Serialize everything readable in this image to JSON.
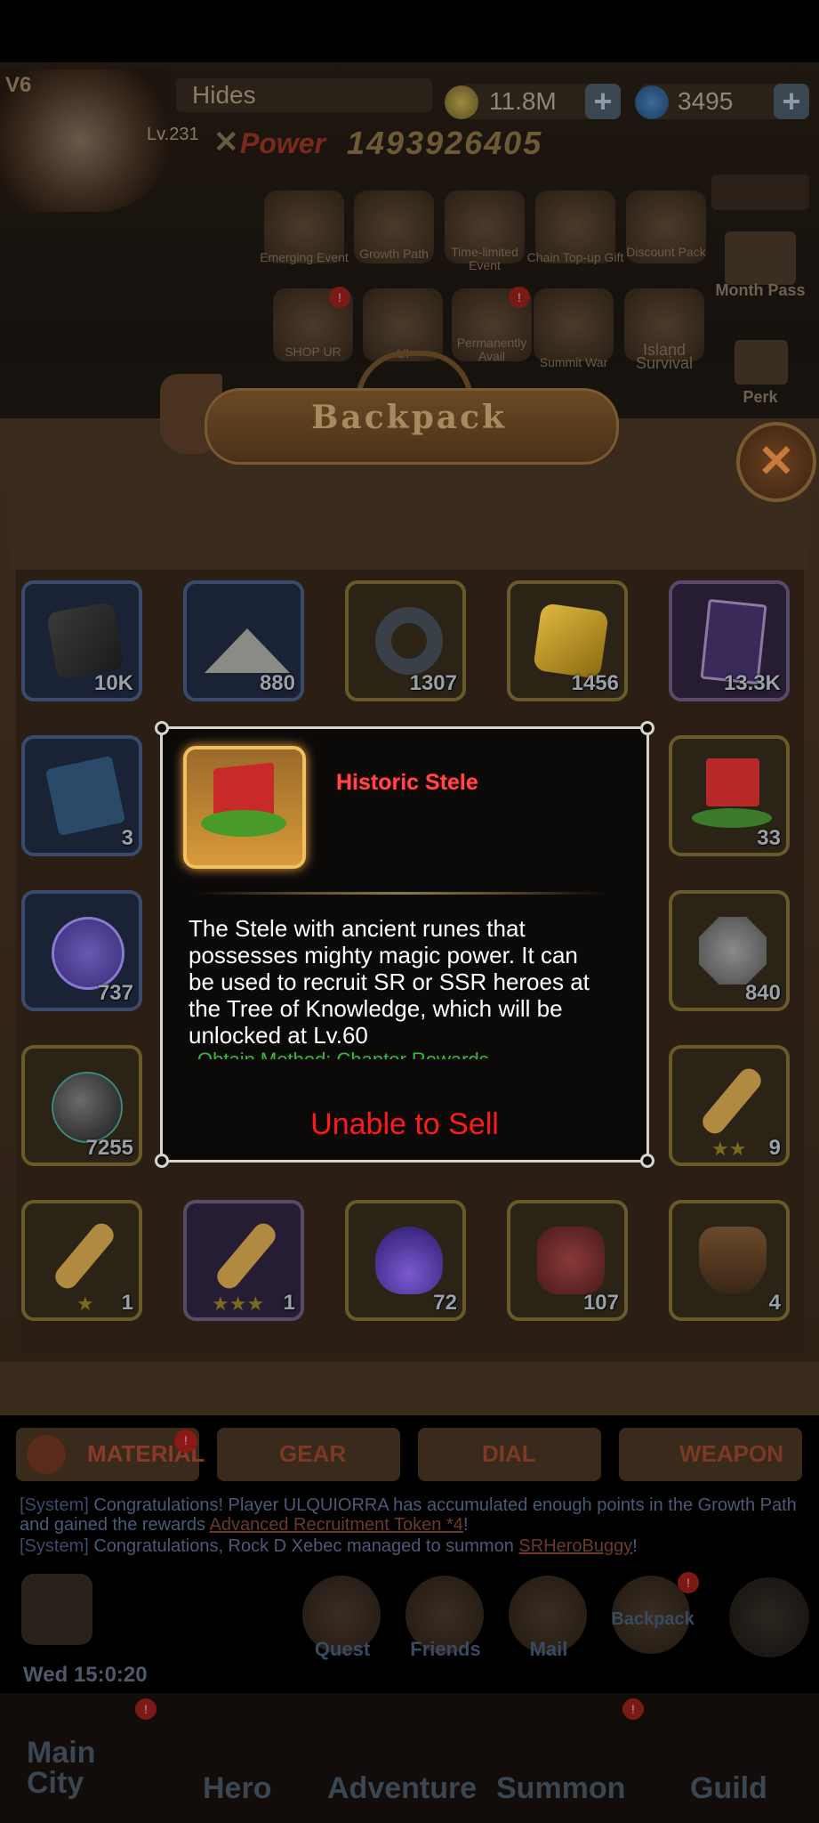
{
  "player": {
    "vip": "V6",
    "name": "Hides",
    "level": "Lv.231",
    "power_label": "Power",
    "power": "1493926405",
    "gold": "11.8M",
    "gems": "3495"
  },
  "events": [
    {
      "label": "Emerging Event"
    },
    {
      "label": "Growth Path"
    },
    {
      "label": "Time-limited Event"
    },
    {
      "label": "Chain Top-up Gift"
    },
    {
      "label": "Discount Pack"
    },
    {
      "label": "SHOP UR"
    },
    {
      "label": "Ul"
    },
    {
      "label": "Permanently Avail"
    },
    {
      "label": "Summit War"
    },
    {
      "label": "Island Survival"
    }
  ],
  "side_buttons": {
    "month_pass": "Month Pass",
    "perk": "Perk"
  },
  "backpack": {
    "title": "Backpack",
    "items": [
      {
        "qty": "10K",
        "frame": "blue",
        "icon": "ore-icon"
      },
      {
        "qty": "880",
        "frame": "blue",
        "icon": "dust-pile-icon"
      },
      {
        "qty": "1307",
        "frame": "gold",
        "icon": "compass-ring-icon"
      },
      {
        "qty": "1456",
        "frame": "gold",
        "icon": "gold-crystal-icon"
      },
      {
        "qty": "13.3K",
        "frame": "purple",
        "icon": "card-icon"
      },
      {
        "qty": "3",
        "frame": "blue",
        "icon": "book-icon"
      },
      {
        "qty": "33",
        "frame": "gold",
        "icon": "stele-icon"
      },
      {
        "qty": "737",
        "frame": "blue",
        "icon": "coin-icon"
      },
      {
        "qty": "840",
        "frame": "gold",
        "icon": "rune-stone-icon"
      },
      {
        "qty": "7255",
        "frame": "gold",
        "icon": "cannonball-icon"
      },
      {
        "qty": "9",
        "frame": "gold",
        "icon": "key-icon"
      },
      {
        "qty": "1",
        "frame": "gold",
        "icon": "key-icon"
      },
      {
        "qty": "1",
        "frame": "purple",
        "icon": "key-icon"
      },
      {
        "qty": "72",
        "frame": "gold",
        "icon": "flame-icon"
      },
      {
        "qty": "107",
        "frame": "gold",
        "icon": "red-ore-icon"
      },
      {
        "qty": "4",
        "frame": "gold",
        "icon": "ship-icon"
      }
    ]
  },
  "tabs": [
    {
      "label": "MATERIAL",
      "badge": "!"
    },
    {
      "label": "GEAR"
    },
    {
      "label": "DIAL"
    },
    {
      "label": "WEAPON"
    }
  ],
  "chat": {
    "line1_tag": "[System]",
    "line1": "Congratulations! Player ULQUIORRA has accumulated enough points in the Growth Path and gained the rewards",
    "line1_link": "Advanced Recruitment Token *4",
    "line2_tag": "[System]",
    "line2": "Congratulations, Rock D Xebec managed to summon",
    "line2_link": "SRHeroBuggy"
  },
  "bottom_buttons": [
    "Quest",
    "Friends",
    "Mail",
    "Backpack"
  ],
  "clock": "Wed 15:0:20",
  "nav": [
    "Main City",
    "Hero",
    "Adventure",
    "Summon",
    "Guild"
  ],
  "tooltip": {
    "name": "Historic Stele",
    "description": "The Stele with ancient runes that possesses mighty magic power. It can be used to recruit SR or SSR heroes at the Tree of Knowledge, which will be unlocked at Lv.60",
    "obtain": "Obtain Method: Chapter Rewards",
    "action": "Unable to Sell"
  },
  "colors": {
    "tooltip_title": "#ff4a4a",
    "unable": "#ff1a1a",
    "obtain": "#3ab83a"
  }
}
